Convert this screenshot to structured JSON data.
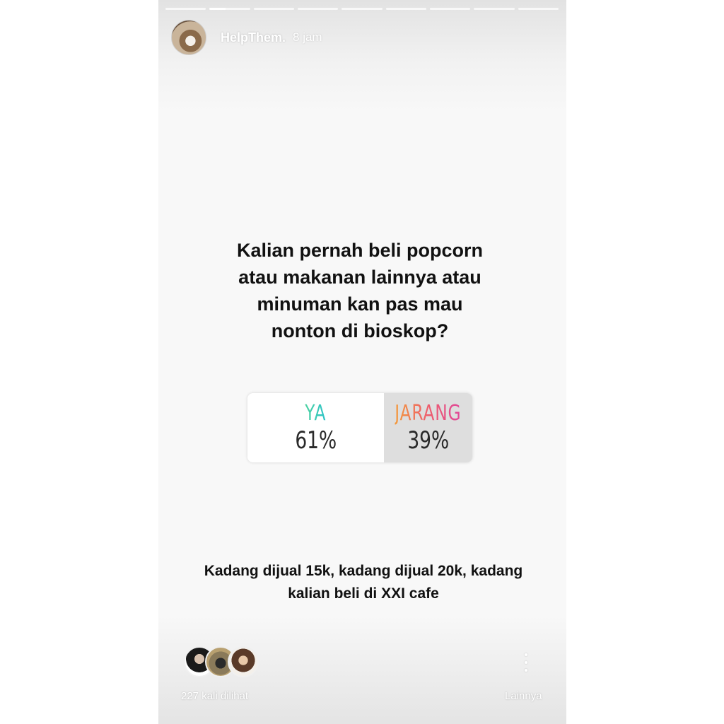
{
  "story": {
    "segments": 9,
    "active_segment": 2
  },
  "header": {
    "username": "HelpThem.",
    "timestamp": "8 jam"
  },
  "question": "Kalian pernah beli popcorn\natau makanan lainnya atau\nminuman kan pas mau\nnonton di bioskop?",
  "poll": {
    "options": [
      {
        "label": "YA",
        "percent": "61%",
        "value": 61
      },
      {
        "label": "JARANG",
        "percent": "39%",
        "value": 39
      }
    ],
    "colors": {
      "ya": "#35c9a8",
      "jarang": "#ee5d6c"
    }
  },
  "caption": "Kadang dijual 15k, kadang dijual 20k,  kadang\nkalian beli di  XXI cafe",
  "footer": {
    "views": "227 kali dilihat",
    "more_label": "Lainnya",
    "more_icon": "more-vertical-icon"
  }
}
